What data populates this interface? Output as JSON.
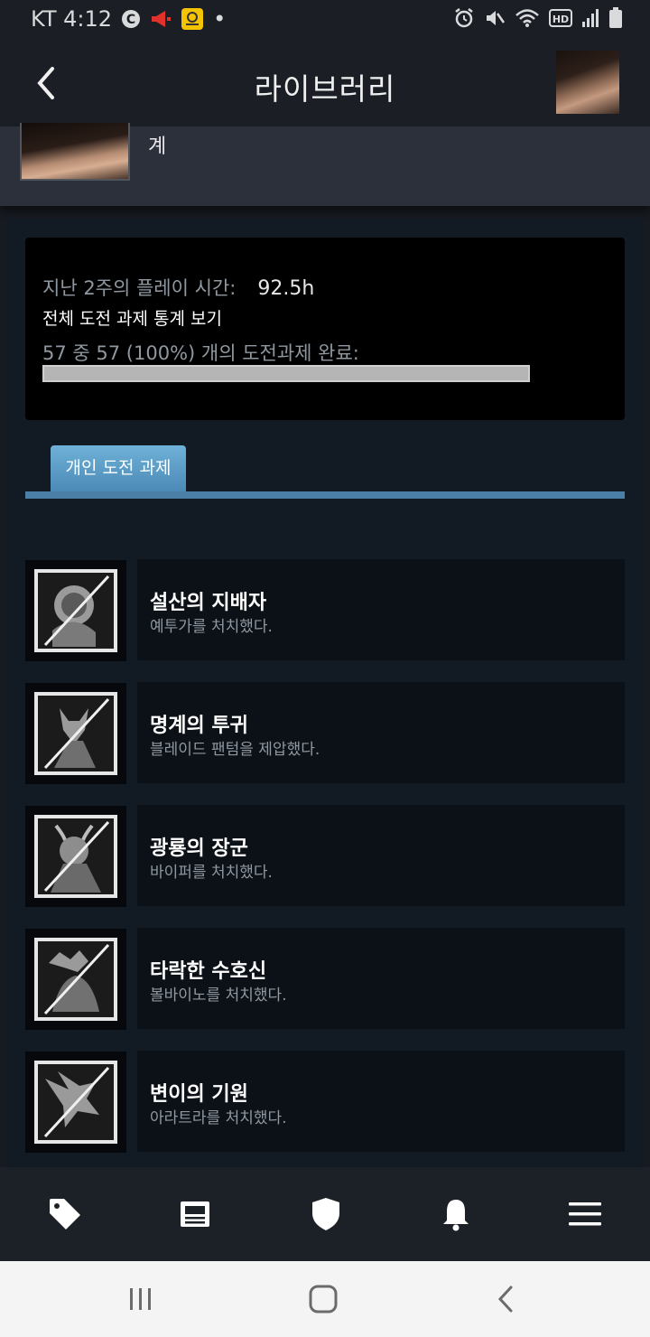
{
  "status_bar": {
    "carrier_time": "KT 4:12",
    "dot": "•",
    "icons": [
      "c-circle-icon",
      "megaphone-icon",
      "app-badge-icon",
      "alarm-icon",
      "mute-icon",
      "wifi-icon",
      "hd-icon",
      "signal-icon",
      "battery-icon"
    ],
    "hd_label": "HD"
  },
  "nav": {
    "title": "라이브러리"
  },
  "profile": {
    "name_fragment": "계"
  },
  "stats": {
    "playtime_label": "지난 2주의 플레이 시간:",
    "playtime_value": "92.5h",
    "view_all_link": "전체 도전 과제 통계 보기",
    "progress_label": "57 중 57 (100%) 개의 도전과제 완료:",
    "progress_fraction": 1.0
  },
  "tabs": [
    {
      "label": "개인 도전 과제",
      "active": true
    }
  ],
  "achievements": [
    {
      "name": "설산의 지배자",
      "desc": "예투가를 처치했다."
    },
    {
      "name": "명계의 투귀",
      "desc": "블레이드 팬텀을 제압했다."
    },
    {
      "name": "광룡의 장군",
      "desc": "바이퍼를 처치했다."
    },
    {
      "name": "타락한 수호신",
      "desc": "볼바이노를 처치했다."
    },
    {
      "name": "변이의 기원",
      "desc": "아라트라를 처치했다."
    }
  ],
  "bottom_nav": [
    "tag-icon",
    "news-icon",
    "shield-icon",
    "bell-icon",
    "menu-icon"
  ],
  "system_nav": [
    "recents-icon",
    "home-icon",
    "back-icon"
  ],
  "colors": {
    "background": "#171a21",
    "accent": "#4b7fa6",
    "tab_active": "#5b9bc8",
    "muted_text": "#8f98a0"
  }
}
